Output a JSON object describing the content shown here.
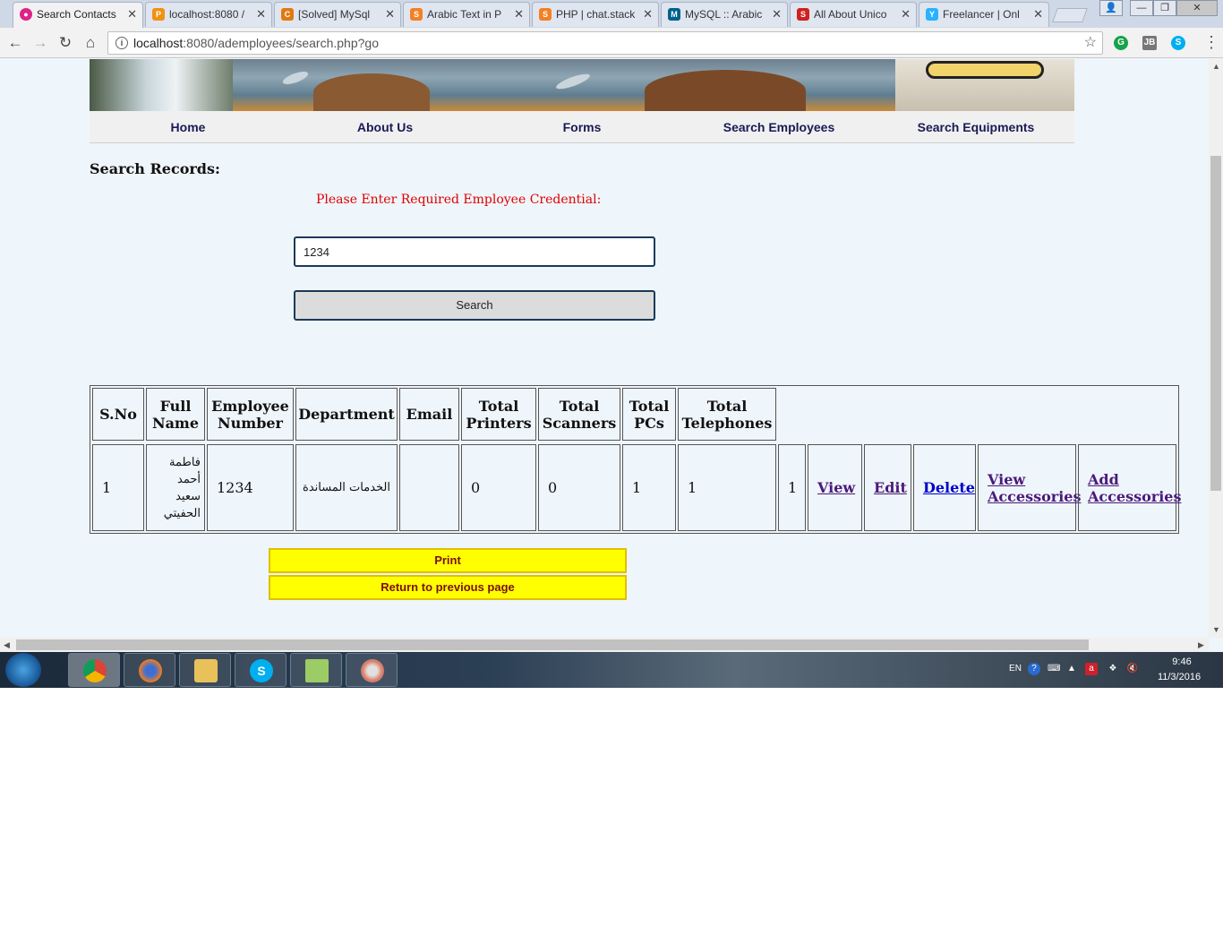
{
  "browser": {
    "tabs": [
      {
        "label": "Search Contacts",
        "icon": "pink-circle-icon",
        "color": "#e0218a",
        "active": true
      },
      {
        "label": "localhost:8080 /",
        "icon": "phpmyadmin-icon",
        "color": "#f29111"
      },
      {
        "label": "[Solved] MySql",
        "icon": "codeproject-icon",
        "color": "#e07a10"
      },
      {
        "label": "Arabic Text in P",
        "icon": "stackoverflow-icon",
        "color": "#f48024"
      },
      {
        "label": "PHP | chat.stack",
        "icon": "stackoverflow-icon",
        "color": "#f48024"
      },
      {
        "label": "MySQL :: Arabic",
        "icon": "mysql-icon",
        "color": "#00618a"
      },
      {
        "label": "All About Unico",
        "icon": "site-icon",
        "color": "#d02020"
      },
      {
        "label": "Freelancer | Onl",
        "icon": "freelancer-icon",
        "color": "#29b2fe"
      }
    ],
    "url_host": "localhost",
    "url_rest": ":8080/ademployees/search.php?go"
  },
  "nav": {
    "items": [
      "Home",
      "About Us",
      "Forms",
      "Search Employees",
      "Search Equipments"
    ]
  },
  "search": {
    "heading": "Search Records:",
    "prompt": "Please Enter Required Employee Credential:",
    "value": "1234",
    "button": "Search"
  },
  "table": {
    "headers": {
      "sno": "S.No",
      "full_name": "Full Name",
      "employee_number": "Employee Number",
      "department": "Department",
      "email": "Email",
      "printers": "Total Printers",
      "scanners": "Total Scanners",
      "pcs": "Total PCs",
      "telephones": "Total Telephones"
    },
    "row": {
      "sno": "1",
      "full_name": "فاطمة أحمد سعيد الحفيتي",
      "employee_number": "1234",
      "department": "الخدمات المساندة",
      "email": "",
      "printers": "0",
      "scanners": "0",
      "pcs": "1",
      "telephones": "1",
      "extra": "1",
      "view": "View",
      "edit": "Edit",
      "delete": "Delete",
      "view_accessories": "View Accessories",
      "add_accessories": "Add Accessories"
    }
  },
  "actions": {
    "print": "Print",
    "back": "Return to previous page"
  },
  "system": {
    "language": "EN",
    "time": "9:46",
    "date": "11/3/2016"
  }
}
